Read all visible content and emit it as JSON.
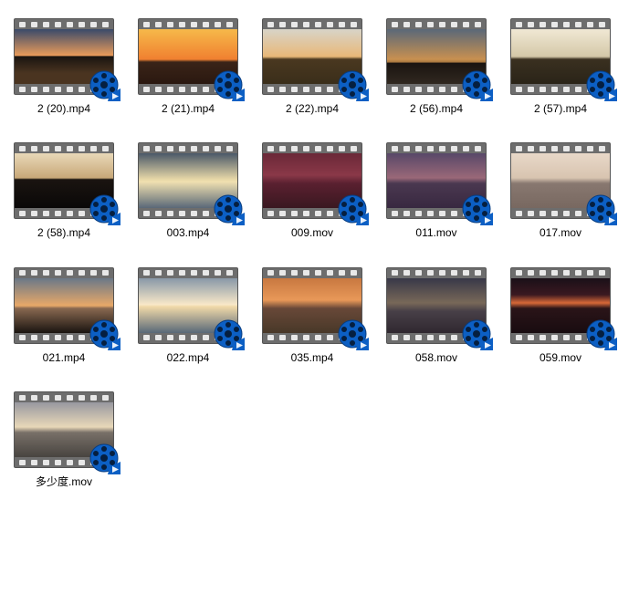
{
  "files": [
    {
      "name": "2 (20).mp4",
      "thumb": "sunset1"
    },
    {
      "name": "2 (21).mp4",
      "thumb": "sunset2"
    },
    {
      "name": "2 (22).mp4",
      "thumb": "windmill1"
    },
    {
      "name": "2 (56).mp4",
      "thumb": "rock"
    },
    {
      "name": "2 (57).mp4",
      "thumb": "windmill2"
    },
    {
      "name": "2 (58).mp4",
      "thumb": "windmill3"
    },
    {
      "name": "003.mp4",
      "thumb": "reflection"
    },
    {
      "name": "009.mov",
      "thumb": "redsea"
    },
    {
      "name": "011.mov",
      "thumb": "purplesea"
    },
    {
      "name": "017.mov",
      "thumb": "palesea"
    },
    {
      "name": "021.mp4",
      "thumb": "coast1"
    },
    {
      "name": "022.mp4",
      "thumb": "sunsea"
    },
    {
      "name": "035.mp4",
      "thumb": "orangesea"
    },
    {
      "name": "058.mov",
      "thumb": "cloudsea"
    },
    {
      "name": "059.mov",
      "thumb": "darksun"
    },
    {
      "name": "多少度.mov",
      "thumb": "rockywave"
    }
  ]
}
